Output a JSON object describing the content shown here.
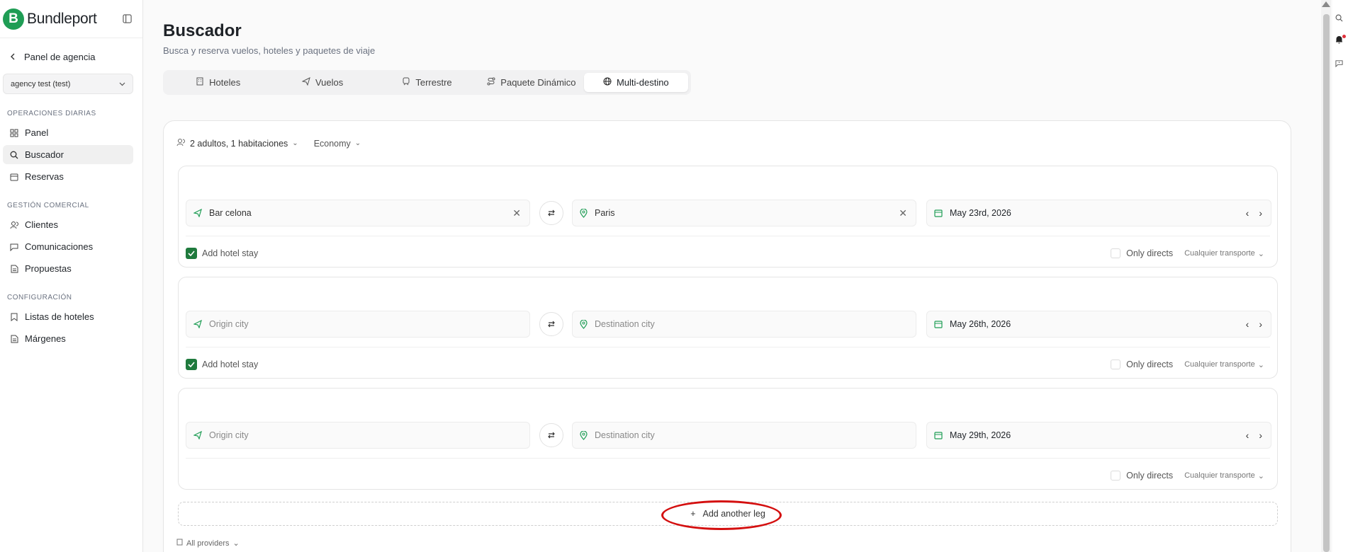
{
  "brand": {
    "name": "Bundleport",
    "logo_letter": "B",
    "accent": "#1f9d55"
  },
  "sidebar": {
    "back_label": "Panel de agencia",
    "agency": "agency test (test)",
    "sections": [
      {
        "title": "OPERACIONES DIARIAS",
        "items": [
          {
            "label": "Panel",
            "icon": "grid-icon"
          },
          {
            "label": "Buscador",
            "icon": "search-icon",
            "active": true
          },
          {
            "label": "Reservas",
            "icon": "calendar-icon"
          }
        ]
      },
      {
        "title": "GESTIÓN COMERCIAL",
        "items": [
          {
            "label": "Clientes",
            "icon": "users-icon"
          },
          {
            "label": "Comunicaciones",
            "icon": "message-icon"
          },
          {
            "label": "Propuestas",
            "icon": "document-icon"
          }
        ]
      },
      {
        "title": "CONFIGURACIÓN",
        "items": [
          {
            "label": "Listas de hoteles",
            "icon": "bookmark-icon"
          },
          {
            "label": "Márgenes",
            "icon": "document-icon"
          }
        ]
      }
    ]
  },
  "header": {
    "title": "Buscador",
    "subtitle": "Busca y reserva vuelos, hoteles y paquetes de viaje"
  },
  "tabs": [
    {
      "label": "Hoteles",
      "icon": "building-icon"
    },
    {
      "label": "Vuelos",
      "icon": "plane-icon"
    },
    {
      "label": "Terrestre",
      "icon": "train-icon"
    },
    {
      "label": "Paquete Dinámico",
      "icon": "route-icon"
    },
    {
      "label": "Multi-destino",
      "icon": "globe-icon",
      "active": true
    }
  ],
  "search": {
    "passengers": "2 adultos, 1 habitaciones",
    "cabin": "Economy",
    "legs": [
      {
        "origin": "Bar celona",
        "origin_placeholder": "Origin city",
        "destination": "Paris",
        "destination_placeholder": "Destination city",
        "date": "May 23rd, 2026",
        "add_hotel_label": "Add hotel stay",
        "add_hotel_checked": true,
        "only_directs": "Only directs",
        "transport": "Cualquier transporte"
      },
      {
        "origin": "",
        "origin_placeholder": "Origin city",
        "destination": "",
        "destination_placeholder": "Destination city",
        "date": "May 26th, 2026",
        "add_hotel_label": "Add hotel stay",
        "add_hotel_checked": true,
        "only_directs": "Only directs",
        "transport": "Cualquier transporte"
      },
      {
        "origin": "",
        "origin_placeholder": "Origin city",
        "destination": "",
        "destination_placeholder": "Destination city",
        "date": "May 29th, 2026",
        "add_hotel_checked": false,
        "only_directs": "Only directs",
        "transport": "Cualquier transporte"
      }
    ],
    "add_leg_label": "Add another leg",
    "providers": "All providers"
  }
}
